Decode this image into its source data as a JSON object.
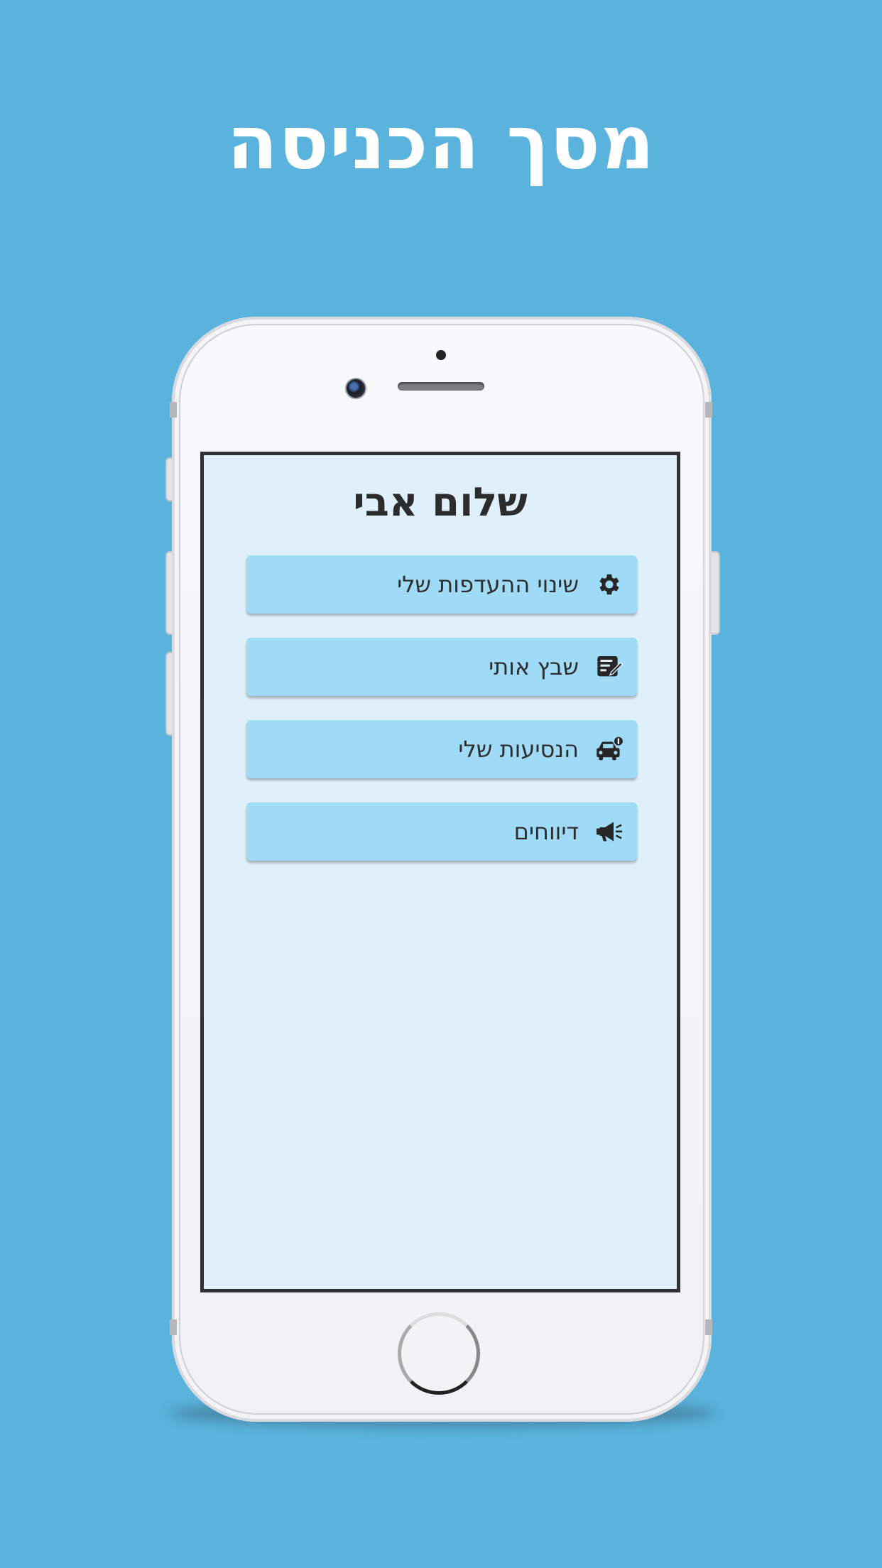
{
  "page": {
    "headline": "מסך הכניסה",
    "background_color": "#5ab3dc"
  },
  "app": {
    "greeting": "שלום אבי",
    "screen_background": "#dff0fb",
    "button_color": "#9fdaf7",
    "menu": [
      {
        "label": "שינוי ההעדפות שלי",
        "icon": "gear-icon"
      },
      {
        "label": "שבץ אותי",
        "icon": "edit-list-icon"
      },
      {
        "label": "הנסיעות שלי",
        "icon": "car-icon"
      },
      {
        "label": "דיווחים",
        "icon": "megaphone-icon"
      }
    ]
  }
}
